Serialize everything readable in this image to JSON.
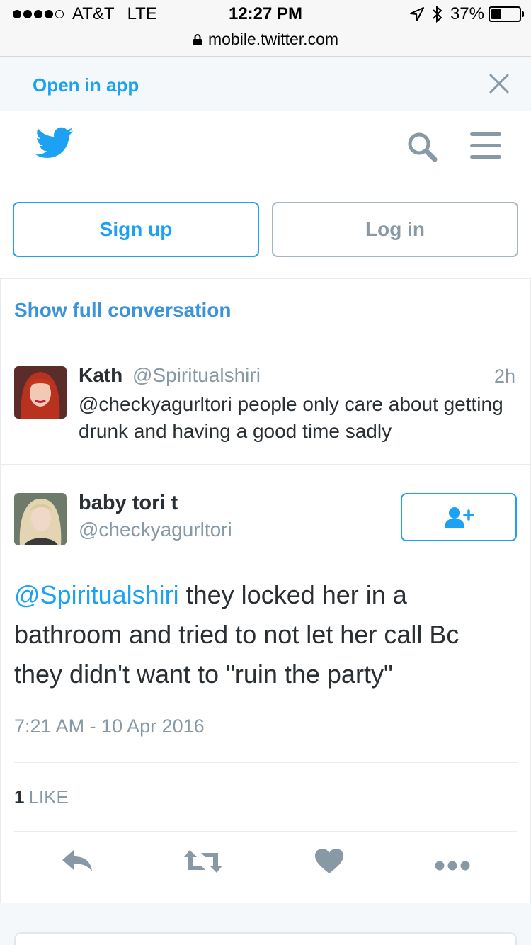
{
  "status_bar": {
    "carrier": "AT&T",
    "network": "LTE",
    "time": "12:27 PM",
    "battery_percent": "37%",
    "battery_level": 0.37,
    "url": "mobile.twitter.com"
  },
  "app_banner": {
    "open_label": "Open in app"
  },
  "auth": {
    "signup_label": "Sign up",
    "login_label": "Log in"
  },
  "conversation": {
    "show_full_label": "Show full conversation",
    "parent_tweet": {
      "name": "Kath",
      "handle": "@Spiritualshiri",
      "time": "2h",
      "text": "@checkyagurltori people only care about getting drunk and having a good time sadly"
    },
    "main_tweet": {
      "name": "baby tori t",
      "handle": "@checkyagurltori",
      "mention": "@Spiritualshiri",
      "text": " they locked her in a bathroom and tried to not let her call Bc they didn't want to \"ruin the party\"",
      "date": "7:21 AM - 10 Apr 2016",
      "like_count": "1",
      "like_label": "LIKE"
    }
  },
  "colors": {
    "brand_blue": "#1da1f2",
    "text": "#292f33",
    "muted": "#8899a6"
  },
  "icons": [
    "location-arrow-icon",
    "bluetooth-icon",
    "battery-icon",
    "lock-icon",
    "close-icon",
    "twitter-bird-icon",
    "search-icon",
    "menu-icon",
    "follow-user-icon",
    "reply-icon",
    "retweet-icon",
    "like-heart-icon",
    "more-icon"
  ]
}
